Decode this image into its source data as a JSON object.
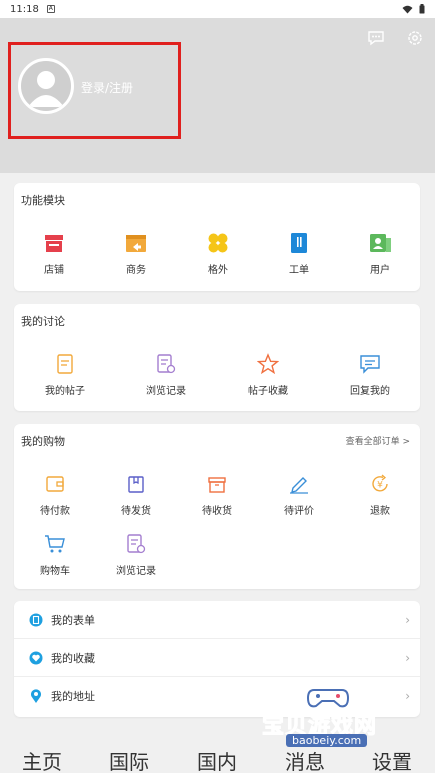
{
  "status": {
    "time": "11:18",
    "notif_glyph": "A"
  },
  "header": {
    "login_text": "登录/注册",
    "colors": {
      "bg": "#dcdcdc",
      "highlight": "#e0201e"
    }
  },
  "modules": {
    "title": "功能模块",
    "items": [
      {
        "label": "店铺",
        "icon": "store-icon",
        "color": "#e5404c"
      },
      {
        "label": "商务",
        "icon": "business-icon",
        "color": "#f2a93b"
      },
      {
        "label": "格外",
        "icon": "clover-icon",
        "color": "#f5c518"
      },
      {
        "label": "工单",
        "icon": "ticket-icon",
        "color": "#1e88d8"
      },
      {
        "label": "用户",
        "icon": "user-card-icon",
        "color": "#5cb85c"
      }
    ]
  },
  "discussion": {
    "title": "我的讨论",
    "items": [
      {
        "label": "我的帖子",
        "icon": "post-icon"
      },
      {
        "label": "浏览记录",
        "icon": "history-icon"
      },
      {
        "label": "帖子收藏",
        "icon": "star-icon"
      },
      {
        "label": "回复我的",
        "icon": "reply-icon"
      }
    ]
  },
  "shopping": {
    "title": "我的购物",
    "link": "查看全部订单 >",
    "items": [
      {
        "label": "待付款",
        "icon": "wallet-icon"
      },
      {
        "label": "待发货",
        "icon": "package-icon"
      },
      {
        "label": "待收货",
        "icon": "box-icon"
      },
      {
        "label": "待评价",
        "icon": "pen-icon"
      },
      {
        "label": "退款",
        "icon": "refund-icon"
      },
      {
        "label": "购物车",
        "icon": "cart-icon"
      },
      {
        "label": "浏览记录",
        "icon": "history-icon"
      }
    ]
  },
  "settings_list": {
    "items": [
      {
        "label": "我的表单",
        "icon": "form-icon",
        "color": "#1ea0e0"
      },
      {
        "label": "我的收藏",
        "icon": "heart-icon",
        "color": "#1ea0e0"
      },
      {
        "label": "我的地址",
        "icon": "location-icon",
        "color": "#1ea0e0"
      }
    ]
  },
  "bottom_nav": {
    "items": [
      "主页",
      "国际",
      "国内",
      "消息",
      "设置"
    ]
  },
  "watermark": {
    "text": "宝贝游戏网",
    "url": "baobeiy.com"
  }
}
